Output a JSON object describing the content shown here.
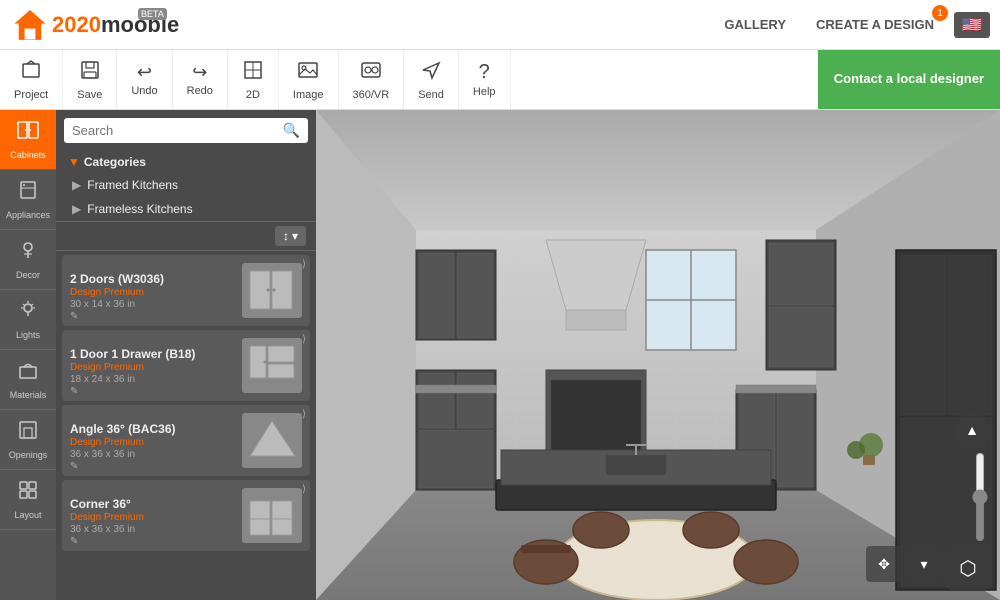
{
  "app": {
    "name": "2020mooble",
    "beta_label": "BETA",
    "notification_count": "1"
  },
  "header": {
    "nav": {
      "gallery": "GALLERY",
      "create": "CREATE A DESIGN"
    }
  },
  "toolbar": {
    "items": [
      {
        "id": "project",
        "label": "Project",
        "icon": "🏠"
      },
      {
        "id": "save",
        "label": "Save",
        "icon": "💾"
      },
      {
        "id": "undo",
        "label": "Undo",
        "icon": "↩"
      },
      {
        "id": "redo",
        "label": "Redo",
        "icon": "↪"
      },
      {
        "id": "2d",
        "label": "2D",
        "icon": "⬜"
      },
      {
        "id": "image",
        "label": "Image",
        "icon": "🖼"
      },
      {
        "id": "360vr",
        "label": "360/VR",
        "icon": "📷"
      },
      {
        "id": "send",
        "label": "Send",
        "icon": "✉"
      },
      {
        "id": "help",
        "label": "Help",
        "icon": "❓"
      }
    ],
    "contact_button": "Contact a local designer"
  },
  "sidebar": {
    "items": [
      {
        "id": "cabinets",
        "label": "Cabinets",
        "icon": "▦",
        "active": true
      },
      {
        "id": "appliances",
        "label": "Appliances",
        "icon": "🔧"
      },
      {
        "id": "decor",
        "label": "Decor",
        "icon": "🌿"
      },
      {
        "id": "lights",
        "label": "Lights",
        "icon": "💡"
      },
      {
        "id": "materials",
        "label": "Materials",
        "icon": "🎨"
      },
      {
        "id": "openings",
        "label": "Openings",
        "icon": "🚪"
      },
      {
        "id": "layout",
        "label": "Layout",
        "icon": "⊞"
      }
    ]
  },
  "panel": {
    "search_placeholder": "Search",
    "categories_label": "Categories",
    "categories": [
      {
        "label": "Framed Kitchens"
      },
      {
        "label": "Frameless Kitchens"
      }
    ],
    "sort_label": "↕",
    "items": [
      {
        "name": "2 Doors (W3036)",
        "badge": "Design Premium",
        "size": "30 x 14 x 36 in"
      },
      {
        "name": "1 Door 1 Drawer (B18)",
        "badge": "Design Premium",
        "size": "18 x 24 x 36 in"
      },
      {
        "name": "Angle 36° (BAC36)",
        "badge": "Design Premium",
        "size": "36 x 36 x 36 in"
      },
      {
        "name": "Corner 36°",
        "badge": "Design Premium",
        "size": "36 x 36 x 36 in"
      }
    ]
  },
  "colors": {
    "orange": "#f60",
    "green": "#4caf50",
    "sidebar_bg": "#555",
    "panel_bg": "#4a4a4a",
    "active_sidebar": "#f60"
  }
}
